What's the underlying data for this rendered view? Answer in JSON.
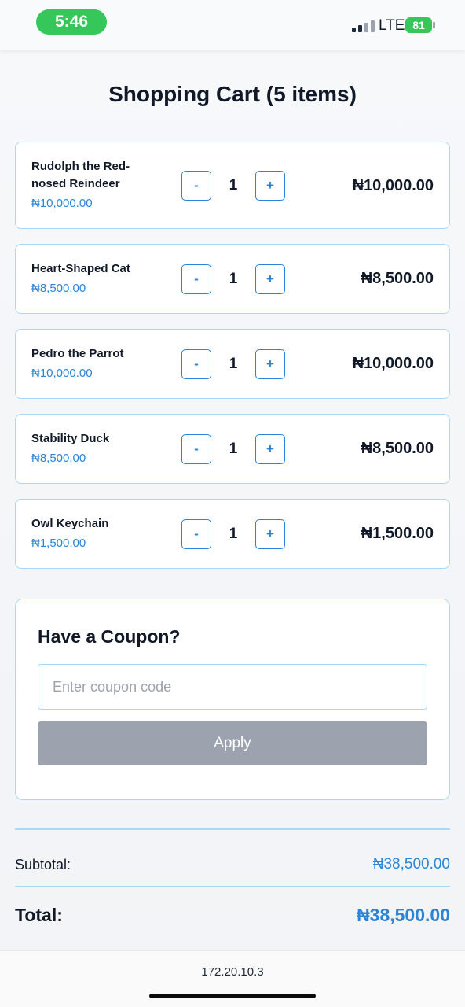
{
  "status_bar": {
    "time": "5:46",
    "network": "LTE",
    "battery": "81"
  },
  "page": {
    "title": "Shopping Cart (5 items)"
  },
  "cart": {
    "items": [
      {
        "name": "Rudolph the Red-nosed Reindeer",
        "unit_price": "₦10,000.00",
        "quantity": "1",
        "line_total": "₦10,000.00"
      },
      {
        "name": "Heart-Shaped Cat",
        "unit_price": "₦8,500.00",
        "quantity": "1",
        "line_total": "₦8,500.00"
      },
      {
        "name": "Pedro the Parrot",
        "unit_price": "₦10,000.00",
        "quantity": "1",
        "line_total": "₦10,000.00"
      },
      {
        "name": "Stability Duck",
        "unit_price": "₦8,500.00",
        "quantity": "1",
        "line_total": "₦8,500.00"
      },
      {
        "name": "Owl Keychain",
        "unit_price": "₦1,500.00",
        "quantity": "1",
        "line_total": "₦1,500.00"
      }
    ],
    "decrement_label": "-",
    "increment_label": "+"
  },
  "coupon": {
    "title": "Have a Coupon?",
    "placeholder": "Enter coupon code",
    "value": "",
    "apply_label": "Apply"
  },
  "totals": {
    "subtotal_label": "Subtotal:",
    "subtotal_value": "₦38,500.00",
    "total_label": "Total:",
    "total_value": "₦38,500.00"
  },
  "browser": {
    "url": "172.20.10.3"
  },
  "colors": {
    "accent": "#2a85d9",
    "border": "#a9d8f5",
    "disabled": "#9ca3af",
    "status_green": "#35c759"
  }
}
